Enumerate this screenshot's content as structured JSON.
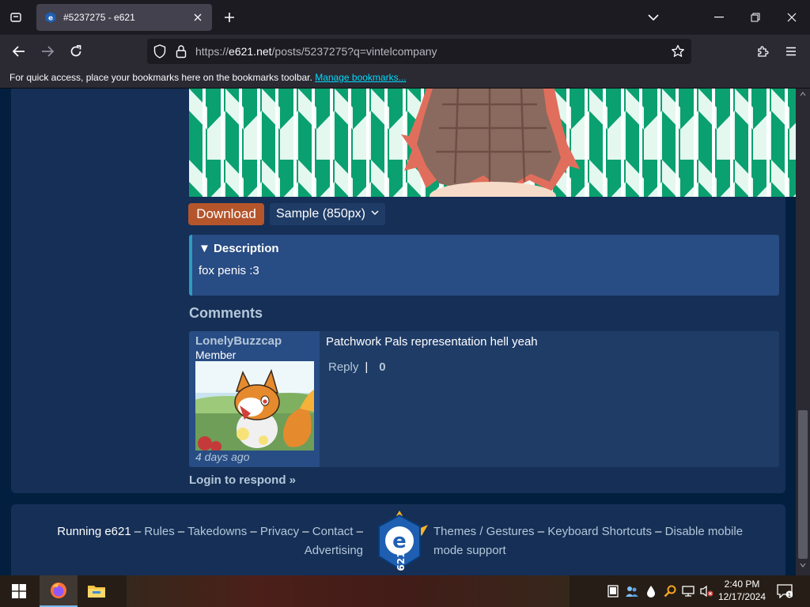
{
  "browser": {
    "tab_title": "#5237275 - e621",
    "url_domain": "e621.net",
    "url_prefix": "https://",
    "url_path": "/posts/5237275?q=vintelcompany",
    "bookmarks_hint": "For quick access, place your bookmarks here on the bookmarks toolbar.",
    "manage_bookmarks": "Manage bookmarks..."
  },
  "post": {
    "download_label": "Download",
    "sample_select": "Sample (850px)",
    "description_summary": "▼ Description",
    "description_text": "fox penis :3"
  },
  "comments": {
    "heading": "Comments",
    "items": [
      {
        "author": "LonelyBuzzcap",
        "level": "Member",
        "date": "4 days ago",
        "text": "Patchwork Pals representation hell yeah",
        "reply": "Reply",
        "separator": "|",
        "score": "0"
      }
    ],
    "login_respond": "Login to respond »"
  },
  "footer": {
    "running": "Running e621",
    "left_links": [
      "Rules",
      "Takedowns",
      "Privacy",
      "Contact",
      "Advertising"
    ],
    "right_links": [
      "Themes / Gestures",
      "Keyboard Shortcuts",
      "Disable mobile mode support"
    ],
    "dash": "–"
  },
  "taskbar": {
    "time": "2:40 PM",
    "date": "12/17/2024",
    "notification_count": "1"
  },
  "colors": {
    "page_bg": "#021f3f",
    "panel_bg": "#152f56",
    "link": "#b4c7d9",
    "download_btn": "#b4552c",
    "description_border": "#2e9bc3"
  }
}
